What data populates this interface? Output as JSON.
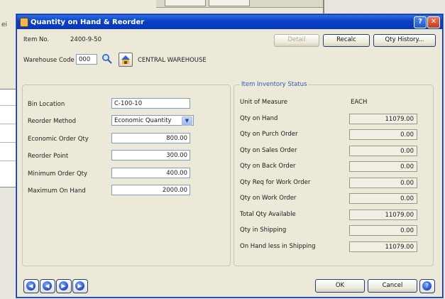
{
  "background": {
    "side_text": "ei"
  },
  "window": {
    "title": "Quantity on Hand & Reorder",
    "help_glyph": "?",
    "close_glyph": "✕"
  },
  "header": {
    "item_no_label": "Item No.",
    "item_no_value": "2400-9-50",
    "warehouse_label": "Warehouse Code",
    "warehouse_value": "000",
    "warehouse_name": "CENTRAL WAREHOUSE"
  },
  "toolbar": {
    "detail_label": "Detail",
    "recalc_label": "Recalc",
    "qty_history_label": "Qty History..."
  },
  "left_form": {
    "bin_location_label": "Bin Location",
    "bin_location_value": "C-100-10",
    "reorder_method_label": "Reorder Method",
    "reorder_method_value": "Economic Quantity",
    "economic_order_qty_label": "Economic Order Qty",
    "economic_order_qty_value": "800.00",
    "reorder_point_label": "Reorder Point",
    "reorder_point_value": "300.00",
    "minimum_order_qty_label": "Minimum Order Qty",
    "minimum_order_qty_value": "400.00",
    "maximum_on_hand_label": "Maximum On Hand",
    "maximum_on_hand_value": "2000.00"
  },
  "inventory_status": {
    "title": "Item Inventory Status",
    "rows": [
      {
        "label": "Unit of Measure",
        "value": "EACH"
      },
      {
        "label": "Qty on Hand",
        "value": "11079.00"
      },
      {
        "label": "Qty on Purch Order",
        "value": "0.00"
      },
      {
        "label": "Qty on Sales Order",
        "value": "0.00"
      },
      {
        "label": "Qty on Back Order",
        "value": "0.00"
      },
      {
        "label": "Qty Req for Work Order",
        "value": "0.00"
      },
      {
        "label": "Qty on Work Order",
        "value": "0.00"
      },
      {
        "label": "Total Qty Available",
        "value": "11079.00"
      },
      {
        "label": "Qty in Shipping",
        "value": "0.00"
      },
      {
        "label": "On Hand less in Shipping",
        "value": "11079.00"
      }
    ]
  },
  "footer": {
    "ok_label": "OK",
    "cancel_label": "Cancel",
    "help_glyph": "?"
  },
  "icons": {
    "lookup": "magnifier-icon",
    "warehouse": "warehouse-icon",
    "nav": [
      "first-record-icon",
      "previous-record-icon",
      "next-record-icon",
      "last-record-icon"
    ],
    "nav_glyphs": [
      "◀",
      "◀",
      "▶",
      "▶"
    ]
  },
  "colors": {
    "titlebar": "#0a3fc8",
    "group_title": "#2b5bb8",
    "close": "#c53a1c"
  }
}
